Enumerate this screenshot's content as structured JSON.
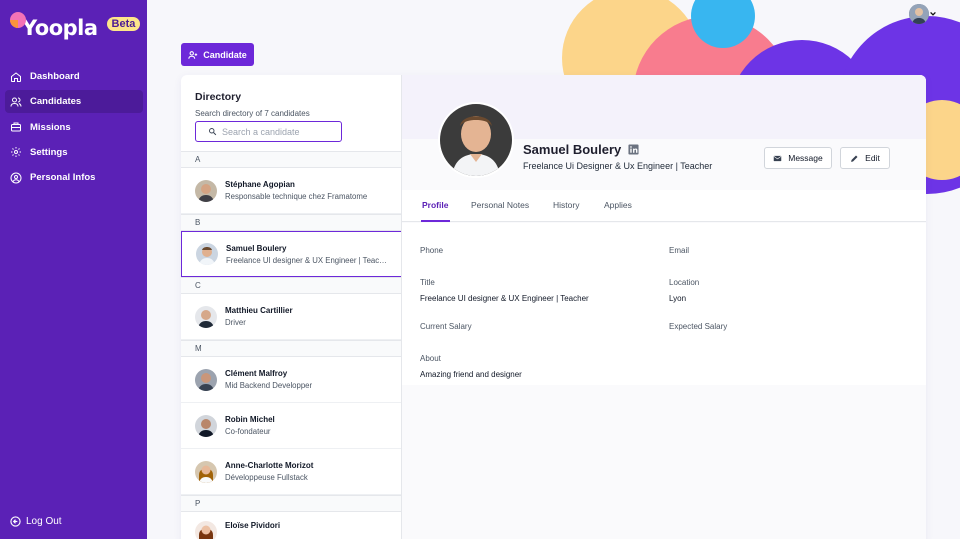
{
  "brand": {
    "name": "Yoopla",
    "badge": "Beta"
  },
  "nav": [
    {
      "label": "Dashboard",
      "icon": "home-icon"
    },
    {
      "label": "Candidates",
      "icon": "users-icon",
      "active": true
    },
    {
      "label": "Missions",
      "icon": "briefcase-icon"
    },
    {
      "label": "Settings",
      "icon": "gear-icon"
    },
    {
      "label": "Personal Infos",
      "icon": "user-circle-icon"
    }
  ],
  "logout_label": "Log Out",
  "add_candidate_label": "Candidate",
  "directory": {
    "title": "Directory",
    "subtitle": "Search directory of 7 candidates",
    "search_placeholder": "Search a candidate",
    "groups": [
      {
        "letter": "A",
        "people": [
          {
            "name": "Stéphane Agopian",
            "role": "Responsable technique chez Framatome"
          }
        ]
      },
      {
        "letter": "B",
        "people": [
          {
            "name": "Samuel Boulery",
            "role": "Freelance UI designer & UX Engineer | Teacher",
            "selected": true
          }
        ]
      },
      {
        "letter": "C",
        "people": [
          {
            "name": "Matthieu Cartillier",
            "role": "Driver"
          }
        ]
      },
      {
        "letter": "M",
        "people": [
          {
            "name": "Clément Malfroy",
            "role": "Mid Backend Developper"
          },
          {
            "name": "Robin Michel",
            "role": "Co-fondateur"
          },
          {
            "name": "Anne-Charlotte Morizot",
            "role": "Développeuse Fullstack"
          }
        ]
      },
      {
        "letter": "P",
        "people": [
          {
            "name": "Eloïse Pividori",
            "role": ""
          }
        ]
      }
    ]
  },
  "profile": {
    "name": "Samuel Boulery",
    "title": "Freelance Ui Designer & Ux Engineer | Teacher",
    "message_label": "Message",
    "edit_label": "Edit",
    "tabs": [
      "Profile",
      "Personal Notes",
      "History",
      "Applies"
    ],
    "active_tab": "Profile",
    "fields": {
      "phone": {
        "label": "Phone",
        "value": ""
      },
      "email": {
        "label": "Email",
        "value": ""
      },
      "title": {
        "label": "Title",
        "value": "Freelance UI designer & UX Engineer | Teacher"
      },
      "location": {
        "label": "Location",
        "value": "Lyon"
      },
      "current_salary": {
        "label": "Current Salary",
        "value": ""
      },
      "expected_salary": {
        "label": "Expected Salary",
        "value": ""
      },
      "about": {
        "label": "About",
        "value": "Amazing friend and designer"
      }
    }
  },
  "colors": {
    "sidebar": "#5b21b6",
    "accent": "#6d28d9",
    "beta": "#fde68a"
  }
}
